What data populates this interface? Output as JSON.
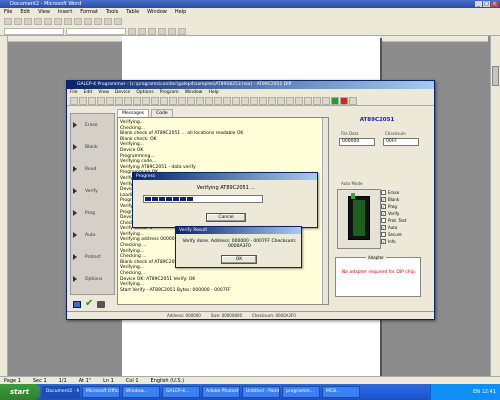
{
  "word": {
    "title": "Document2 - Microsoft Word",
    "menu": [
      "File",
      "Edit",
      "View",
      "Insert",
      "Format",
      "Tools",
      "Table",
      "Window",
      "Help"
    ],
    "status": [
      "Page 1",
      "Sec 1",
      "1/1",
      "At 1\"",
      "Ln 1",
      "Col 1",
      "English (U.S.)"
    ]
  },
  "taskbar": {
    "start_label": "start",
    "buttons": [
      "Document2 - Micr...",
      "Microsoft Office...",
      "Window...",
      "GALEP-4...",
      "Adobe Photoshop",
      "Untitled - Paint",
      "programm...",
      "MCB..."
    ],
    "tray_text": "EN  12:41"
  },
  "app": {
    "title": "GALEP-4 Programmer - [c:\\programs\\conitec\\galep4\\samples\\AT89S8253.hex] - AT89C2051 DIP",
    "menu": [
      "File",
      "Edit",
      "View",
      "Device",
      "Options",
      "Program",
      "Window",
      "Help"
    ],
    "tabs": [
      "Messages",
      "Code"
    ],
    "left_items": [
      "Erase",
      "Blank",
      "Read",
      "Verify",
      "Prog",
      "Auto",
      "Protect",
      "Options"
    ],
    "log_lines": [
      "Verifying...",
      "Checking...",
      "Blank check of AT89C2051 ... all locations readable OK",
      "Blank check: OK",
      "Verifying...",
      "Device OK",
      "Programming...",
      "Verifying code...",
      "Verifying AT89C2051 - data verify",
      "Programming OK",
      "Verifying...",
      "Verify: OK",
      "Device found: AT89C2051",
      "Loading file OK",
      "Programming code...",
      "Verifying program...",
      "Program verification OK",
      "Device: AT89C2051",
      "Checking code...",
      "Verify sector 0",
      "Verifying...",
      "Verifying address 000000 - 0007FF",
      "Checking ...",
      "Verifying...",
      "Checking ...",
      "Blank check of AT89C2051 - all locations readable OK",
      "Verifying...",
      "Checking...",
      "Device OK: AT89C2051 Verify: OK",
      "Verifying...",
      "Start Verify - AT89C2051 Bytes: 000000 - 0007FF"
    ],
    "device_name": "AT89C2051",
    "fields": {
      "file_label": "File Data",
      "file_value": "000000",
      "checksum_label": "Checksum",
      "checksum_value": "00FF"
    },
    "options_title": "Auto Mode",
    "options": [
      {
        "label": "Erase",
        "checked": false
      },
      {
        "label": "Blank",
        "checked": true
      },
      {
        "label": "Prog",
        "checked": true
      },
      {
        "label": "Verify",
        "checked": true
      },
      {
        "label": "Prot. Test",
        "checked": false
      },
      {
        "label": "Auto",
        "checked": true
      },
      {
        "label": "Secure",
        "checked": false
      },
      {
        "label": "Info",
        "checked": true
      }
    ],
    "adapter_title": "Adapter",
    "adapter_message": "No adapter required for DIP chip.",
    "status_items": [
      "Address: 000000",
      "Size: 00000800",
      "Checksum: 0000A3F0"
    ]
  },
  "progress_dialog": {
    "title": "Progress",
    "message": "Verifying AT89C2051 ...",
    "progress_fraction": 0.4,
    "button_label": "Cancel"
  },
  "verify_dialog": {
    "title": "Verify Result",
    "message": "Verify done. Address: 000000 - 0007FF  Checksum: 0000A3F0",
    "button_label": "OK"
  }
}
